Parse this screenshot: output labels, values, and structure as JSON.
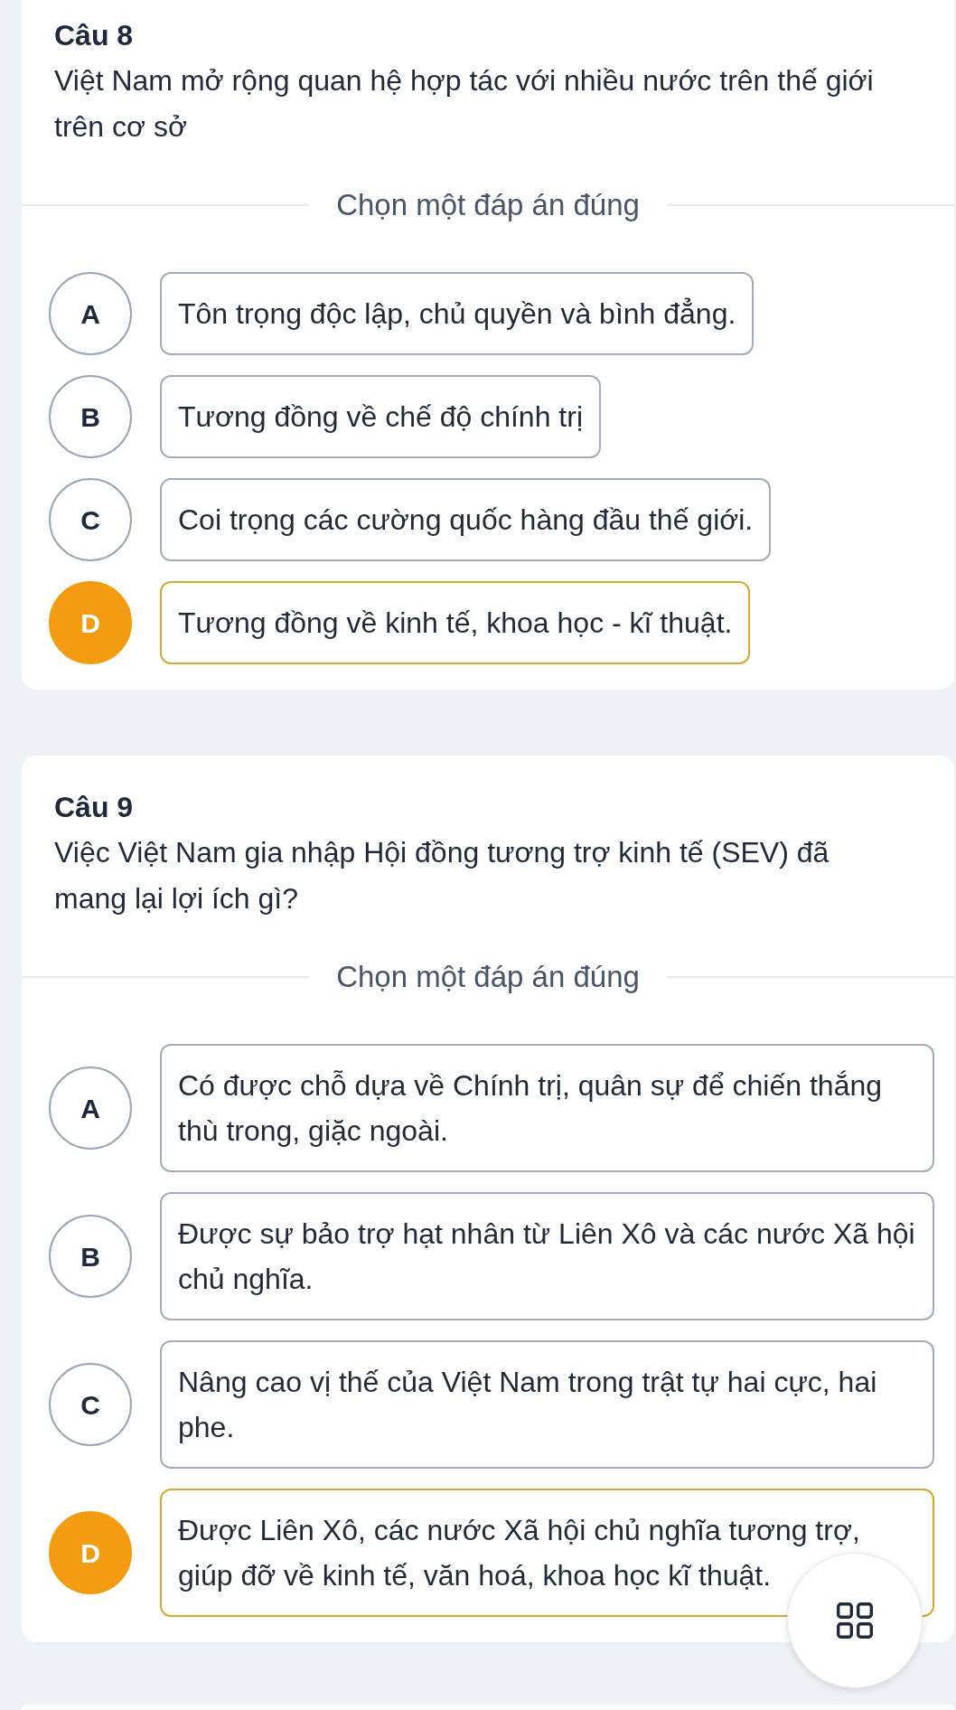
{
  "questions": [
    {
      "number": "Câu 8",
      "prompt": "Việt Nam mở rộng quan hệ hợp tác với nhiều nước trên thế giới trên cơ sở",
      "instruction": "Chọn một đáp án đúng",
      "options": [
        {
          "letter": "A",
          "text": "Tôn trọng độc lập, chủ quyền và bình đẳng.",
          "selected": false
        },
        {
          "letter": "B",
          "text": "Tương đồng về chế độ chính trị",
          "selected": false
        },
        {
          "letter": "C",
          "text": "Coi trọng các cường quốc hàng đầu thế giới.",
          "selected": false
        },
        {
          "letter": "D",
          "text": "Tương đồng về kinh tế, khoa học - kĩ thuật.",
          "selected": true
        }
      ]
    },
    {
      "number": "Câu 9",
      "prompt": "Việc Việt Nam gia nhập Hội đồng tương trợ kinh tế (SEV) đã mang lại lợi ích gì?",
      "instruction": "Chọn một đáp án đúng",
      "options": [
        {
          "letter": "A",
          "text": "Có được chỗ dựa về Chính trị, quân sự để chiến thắng thù trong, giặc ngoài.",
          "selected": false
        },
        {
          "letter": "B",
          "text": "Được sự bảo trợ hạt nhân từ Liên Xô và các nước Xã hội chủ nghĩa.",
          "selected": false
        },
        {
          "letter": "C",
          "text": "Nâng cao vị thế của Việt Nam trong trật tự hai cực, hai phe.",
          "selected": false
        },
        {
          "letter": "D",
          "text": "Được Liên Xô, các nước Xã hội chủ nghĩa tương trợ, giúp đỡ về kinh tế, văn hoá, khoa học kĩ thuật.",
          "selected": true
        }
      ]
    }
  ]
}
